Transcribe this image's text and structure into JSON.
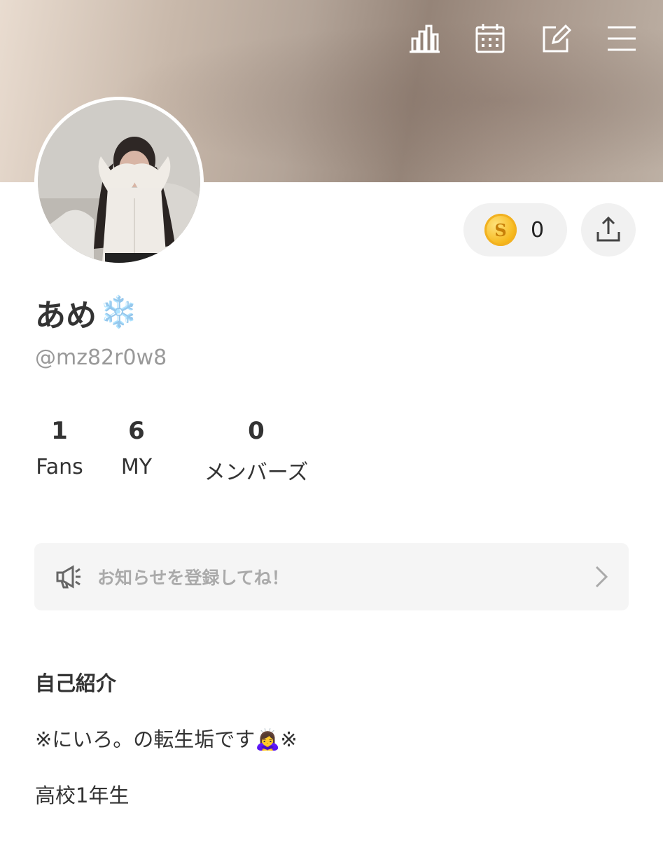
{
  "header": {
    "icons": [
      {
        "name": "stats-icon"
      },
      {
        "name": "calendar-icon"
      },
      {
        "name": "edit-icon"
      },
      {
        "name": "menu-icon"
      }
    ]
  },
  "profile": {
    "display_name": "あめ",
    "name_emoji": "❄️",
    "handle": "@mz82r0w8",
    "coin_count": "0",
    "coin_symbol": "S"
  },
  "stats": [
    {
      "value": "1",
      "label": "Fans"
    },
    {
      "value": "6",
      "label": "MY"
    },
    {
      "value": "0",
      "label": "メンバーズ"
    }
  ],
  "notice": {
    "text": "お知らせを登録してね！"
  },
  "bio": {
    "heading": "自己紹介",
    "line1": "※にいろ。の転生垢です🙇‍♀️※",
    "line2": "高校1年生"
  },
  "colors": {
    "banner_start": "#e9dcd0",
    "banner_mid": "#958478",
    "pill_bg": "#f1f1f1",
    "coin_gold": "#f6b81c"
  }
}
